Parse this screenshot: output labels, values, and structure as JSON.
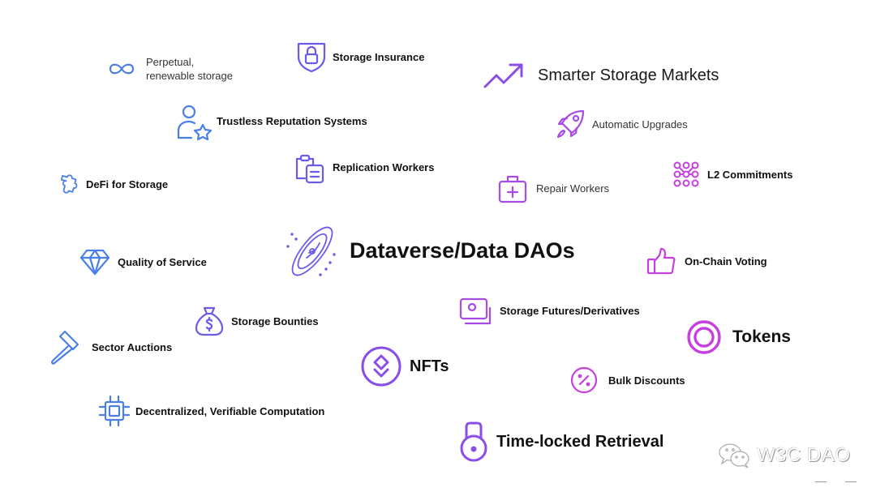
{
  "diagram": {
    "items": [
      {
        "label_line1": "Perpetual,",
        "label_line2": "renewable storage",
        "icon": "infinity-icon"
      },
      {
        "label": "Storage Insurance",
        "icon": "shield-lock-icon"
      },
      {
        "label": "Smarter Storage Markets",
        "icon": "trending-up-icon"
      },
      {
        "label": "Trustless Reputation Systems",
        "icon": "user-star-icon"
      },
      {
        "label": "Automatic Upgrades",
        "icon": "rocket-icon"
      },
      {
        "label": "Replication Workers",
        "icon": "clipboard-copy-icon"
      },
      {
        "label": "DeFi for Storage",
        "icon": "puzzle-icon"
      },
      {
        "label": "Repair Workers",
        "icon": "first-aid-kit-icon"
      },
      {
        "label": "L2 Commitments",
        "icon": "node-grid-icon"
      },
      {
        "label": "Dataverse/Data DAOs",
        "icon": "galaxy-icon"
      },
      {
        "label": "Quality of Service",
        "icon": "diamond-icon"
      },
      {
        "label": "On-Chain Voting",
        "icon": "thumbs-up-icon"
      },
      {
        "label": "Storage Futures/Derivatives",
        "icon": "photo-stack-icon"
      },
      {
        "label": "Storage Bounties",
        "icon": "money-bag-icon"
      },
      {
        "label": "Tokens",
        "icon": "token-ring-icon"
      },
      {
        "label": "Sector Auctions",
        "icon": "gavel-icon"
      },
      {
        "label": "NFTs",
        "icon": "nft-layers-icon"
      },
      {
        "label": "Bulk Discounts",
        "icon": "percent-badge-icon"
      },
      {
        "label": "Decentralized, Verifiable Computation",
        "icon": "cpu-chip-icon"
      },
      {
        "label": "Time-locked Retrieval",
        "icon": "kettlebell-lock-icon"
      }
    ],
    "colors": {
      "blue": "#4a7fe8",
      "indigo": "#6a5ce8",
      "violet": "#8a4ee8",
      "purple": "#a84ae6",
      "magenta": "#c640e0"
    }
  },
  "watermark": {
    "text": "W3C DAO",
    "icon": "wechat-icon"
  }
}
